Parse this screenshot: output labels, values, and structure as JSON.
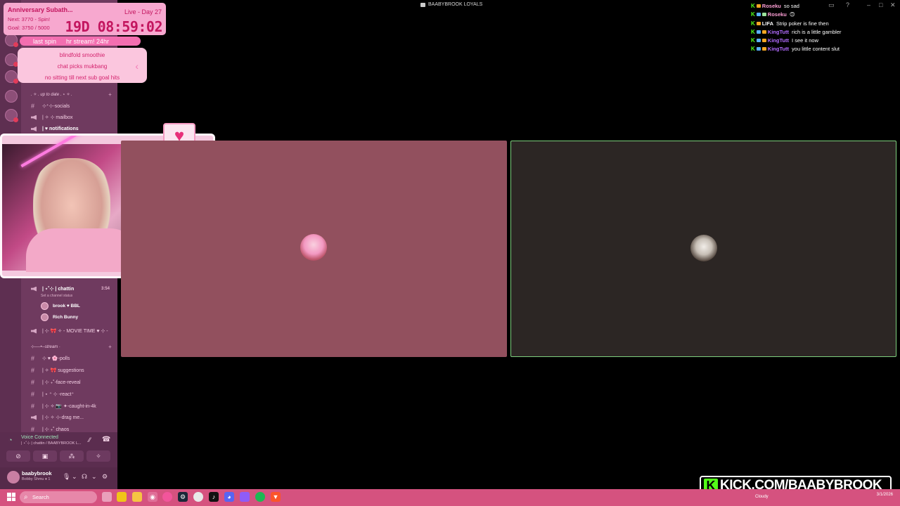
{
  "window": {
    "title": "BAABYBROOK LOYALS"
  },
  "overlay": {
    "title": "Anniversary Subath...",
    "next": "Next: 3770 - Spin!",
    "goal": "Goal: 3750 / 5000",
    "live": "Live - Day 27",
    "timer": "19D 08:59:02",
    "spin_left": "last spin",
    "spin_right": "hr stream! 24hr",
    "wheel_items": [
      "blindfold smoothie",
      "chat picks mukbang",
      "no sitting till next sub goal hits"
    ]
  },
  "sidebar": {
    "category1": ". ✧ . up to date . ⋆ ✧ .",
    "channels_top": [
      {
        "label": "⊹⁺⊹-socials",
        "type": "text"
      },
      {
        "label": "| ✧ ⊹ mailbox",
        "type": "voice"
      },
      {
        "label": "| ♥ notifications",
        "type": "voice"
      }
    ],
    "voice_channel": "| ⋆˚⊹ | chattin",
    "voice_time": "3:54",
    "voice_status": "Set a channel status",
    "voice_users": [
      "brook ♥ BBL",
      "Rich Bunny"
    ],
    "movie": "| ⊹ 🎀 ✧ - MOVIE TIME ♥ ⊹ -",
    "category2": "⊹──•─stream ·",
    "channels_bottom": [
      "⊹ ♥ 🌸-polls",
      "| ✧ 🎀 suggestions",
      "| ⊹ ₊˚-face-reveal",
      "| ⋆ ⁺ ⊹ -react⁺",
      "| ⊹ ✧ 📷 ✦-caught-in-4k",
      "| ⊹ ✧ ⊹-drag me...",
      "| ⊹ ₊˚ chaos"
    ]
  },
  "voice_panel": {
    "status": "Voice Connected",
    "location": "| ⋆˚⊹ | chattin / BAABYBROOK L..."
  },
  "user": {
    "name": "baabybrook",
    "status": "Bobby Shmu ♦ 1"
  },
  "chat": [
    {
      "name": "Roseku",
      "msg": "so sad",
      "color": "#ff9fd6"
    },
    {
      "name": "Roseku",
      "msg": "🙃",
      "color": "#ff9fd6"
    },
    {
      "name": "LIFA",
      "msg": "Strip poker is fine then",
      "color": "#ffffff"
    },
    {
      "name": "KingTutt",
      "msg": "rich is a little gambler",
      "color": "#b26bff"
    },
    {
      "name": "KingTutt",
      "msg": "I see it now",
      "color": "#b26bff"
    },
    {
      "name": "KingTutt",
      "msg": "you little content slut",
      "color": "#b26bff"
    }
  ],
  "kick": {
    "glyph": "K",
    "text": "KICK.COM/BAABYBROOK"
  },
  "taskbar": {
    "search": "Search",
    "weather": "Cloudy",
    "time": "3/1/2026"
  },
  "colors": {
    "accent": "#f36eb0",
    "kick_green": "#53fc18",
    "speaking_border": "#7ed07d"
  }
}
